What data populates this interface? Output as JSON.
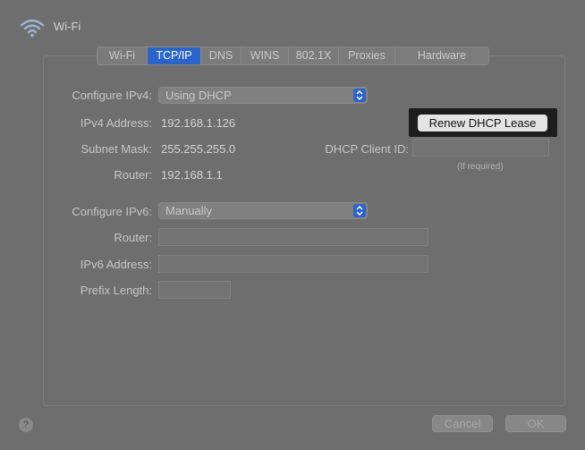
{
  "window": {
    "title": "Wi-Fi",
    "icon": "wifi-icon"
  },
  "tabs": [
    {
      "label": "Wi-Fi"
    },
    {
      "label": "TCP/IP"
    },
    {
      "label": "DNS"
    },
    {
      "label": "WINS"
    },
    {
      "label": "802.1X"
    },
    {
      "label": "Proxies"
    },
    {
      "label": "Hardware"
    }
  ],
  "active_tab": "TCP/IP",
  "ipv4": {
    "configure_label": "Configure IPv4:",
    "configure_value": "Using DHCP",
    "address_label": "IPv4 Address:",
    "address_value": "192.168.1.126",
    "subnet_label": "Subnet Mask:",
    "subnet_value": "255.255.255.0",
    "router_label": "Router:",
    "router_value": "192.168.1.1",
    "renew_button": "Renew DHCP Lease",
    "dhcp_client_id_label": "DHCP Client ID:",
    "dhcp_client_id_value": "",
    "dhcp_client_id_hint": "(If required)"
  },
  "ipv6": {
    "configure_label": "Configure IPv6:",
    "configure_value": "Manually",
    "router_label": "Router:",
    "router_value": "",
    "address_label": "IPv6 Address:",
    "address_value": "",
    "prefix_label": "Prefix Length:",
    "prefix_value": ""
  },
  "footer": {
    "help": "?",
    "cancel": "Cancel",
    "ok": "OK"
  },
  "colors": {
    "accent": "#2a64c8",
    "background": "#6e6e6e"
  }
}
